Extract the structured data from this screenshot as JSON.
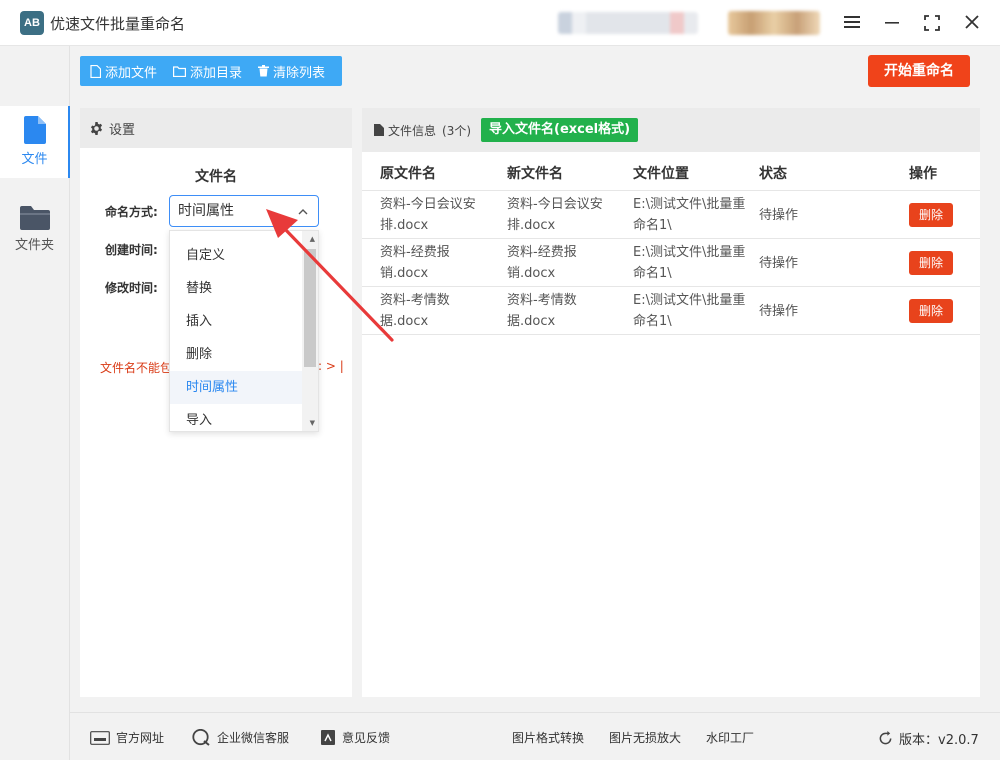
{
  "app": {
    "title": "优速文件批量重命名",
    "logo_text": "AB"
  },
  "nav": {
    "file_label": "文件",
    "folder_label": "文件夹"
  },
  "toolbar": {
    "add_file": "添加文件",
    "add_dir": "添加目录",
    "clear_list": "清除列表",
    "start": "开始重命名"
  },
  "settings": {
    "header": "设置",
    "section_title": "文件名",
    "mode_label": "命名方式:",
    "create_label": "创建时间:",
    "modify_label": "修改时间:",
    "warning": "文件名不能包",
    "warning_tail": ": > |",
    "selected_value": "时间属性",
    "options": [
      "自定义",
      "替换",
      "插入",
      "删除",
      "时间属性",
      "导入"
    ]
  },
  "files": {
    "header": "文件信息",
    "count": "(3个)",
    "import_button": "导入文件名(excel格式)",
    "columns": [
      "原文件名",
      "新文件名",
      "文件位置",
      "状态",
      "操作"
    ],
    "rows": [
      {
        "orig": "资料-今日会议安排.docx",
        "new": "资料-今日会议安排.docx",
        "path": "E:\\测试文件\\批量重命名1\\",
        "status": "待操作",
        "action": "删除"
      },
      {
        "orig": "资料-经费报销.docx",
        "new": "资料-经费报销.docx",
        "path": "E:\\测试文件\\批量重命名1\\",
        "status": "待操作",
        "action": "删除"
      },
      {
        "orig": "资料-考情数据.docx",
        "new": "资料-考情数据.docx",
        "path": "E:\\测试文件\\批量重命名1\\",
        "status": "待操作",
        "action": "删除"
      }
    ]
  },
  "footer": {
    "official_site": "官方网址",
    "wechat_service": "企业微信客服",
    "feedback": "意见反馈",
    "image_convert": "图片格式转换",
    "image_enlarge": "图片无损放大",
    "watermark": "水印工厂",
    "version": "版本：v2.0.7"
  },
  "colors": {
    "accent": "#2b88f0",
    "toolbar": "#3ea9f5",
    "start": "#f0431a",
    "import": "#22b14c",
    "delete": "#e8431c",
    "warning": "#d93a15"
  }
}
